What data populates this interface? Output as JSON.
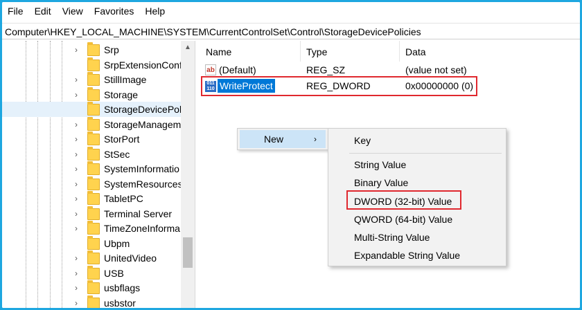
{
  "menubar": {
    "items": [
      "File",
      "Edit",
      "View",
      "Favorites",
      "Help"
    ]
  },
  "address": {
    "path": "Computer\\HKEY_LOCAL_MACHINE\\SYSTEM\\CurrentControlSet\\Control\\StorageDevicePolicies"
  },
  "tree": {
    "items": [
      {
        "label": "Srp",
        "expandable": true
      },
      {
        "label": "SrpExtensionConf",
        "expandable": false
      },
      {
        "label": "StillImage",
        "expandable": true
      },
      {
        "label": "Storage",
        "expandable": true
      },
      {
        "label": "StorageDevicePol",
        "expandable": false,
        "selected": true
      },
      {
        "label": "StorageManagem",
        "expandable": true
      },
      {
        "label": "StorPort",
        "expandable": true
      },
      {
        "label": "StSec",
        "expandable": true
      },
      {
        "label": "SystemInformatio",
        "expandable": true
      },
      {
        "label": "SystemResources",
        "expandable": true
      },
      {
        "label": "TabletPC",
        "expandable": true
      },
      {
        "label": "Terminal Server",
        "expandable": true
      },
      {
        "label": "TimeZoneInforma",
        "expandable": true
      },
      {
        "label": "Ubpm",
        "expandable": false
      },
      {
        "label": "UnitedVideo",
        "expandable": true
      },
      {
        "label": "USB",
        "expandable": true
      },
      {
        "label": "usbflags",
        "expandable": true
      },
      {
        "label": "usbstor",
        "expandable": true
      }
    ]
  },
  "list": {
    "columns": [
      "Name",
      "Type",
      "Data"
    ],
    "rows": [
      {
        "name": "(Default)",
        "type": "REG_SZ",
        "data": "(value not set)",
        "icon": "ab"
      },
      {
        "name": "WriteProtect",
        "type": "REG_DWORD",
        "data": "0x00000000 (0)",
        "icon": "011 110"
      }
    ]
  },
  "context_menu": {
    "new_label": "New",
    "arrow": "›"
  },
  "submenu": {
    "items": [
      "Key",
      "String Value",
      "Binary Value",
      "DWORD (32-bit) Value",
      "QWORD (64-bit) Value",
      "Multi-String Value",
      "Expandable String Value"
    ]
  },
  "colors": {
    "highlight_box": "#e0282e",
    "selection": "#0078d7",
    "frame_border": "#1ea7e0"
  }
}
